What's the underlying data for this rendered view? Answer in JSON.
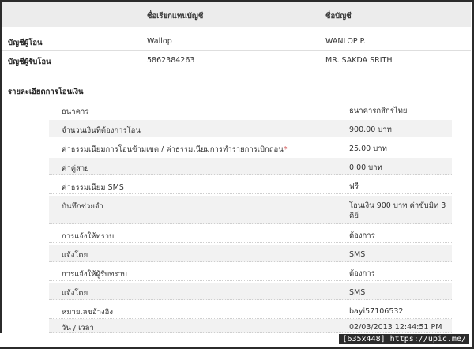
{
  "accounts": {
    "header_nickname": "ชื่อเรียกแทนบัญชี",
    "header_account_name": "ชื่อบัญชี",
    "rows": [
      {
        "label": "บัญชีผู้โอน",
        "nickname": "Wallop",
        "name": "WANLOP P."
      },
      {
        "label": "บัญชีผู้รับโอน",
        "nickname": "5862384263",
        "name": "MR. SAKDA SRITH"
      }
    ]
  },
  "details": {
    "title": "รายละเอียดการโอนเงิน",
    "rows": [
      {
        "key": "ธนาคาร",
        "value": "ธนาคารกสิกรไทย"
      },
      {
        "key": "จำนวนเงินที่ต้องการโอน",
        "value": "900.00 บาท"
      },
      {
        "key": "ค่าธรรมเนียมการโอนข้ามเขต / ค่าธรรมเนียมการทำรายการเบิกถอน",
        "required_mark": "*",
        "value": "25.00 บาท"
      },
      {
        "key": "ค่าคู่สาย",
        "value": "0.00 บาท"
      },
      {
        "key": "ค่าธรรมเนียม SMS",
        "value": "ฟรี"
      },
      {
        "key": "บันทึกช่วยจำ",
        "value": "โอนเงิน 900 บาท ค่าขับมิท 3 คิย์"
      },
      {
        "key": "การแจ้งให้ทราบ",
        "value": "ต้องการ"
      },
      {
        "key": "แจ้งโดย",
        "value": "SMS"
      },
      {
        "key": "การแจ้งให้ผู้รับทราบ",
        "value": "ต้องการ"
      },
      {
        "key": "แจ้งโดย",
        "value": "SMS"
      },
      {
        "key": "หมายเลขอ้างอิง",
        "value": "bayi57106532"
      },
      {
        "key": "วัน / เวลา",
        "value": "02/03/2013 12:44:51 PM"
      }
    ]
  },
  "footer": {
    "tag": "[635x448] https://upic.me/"
  }
}
